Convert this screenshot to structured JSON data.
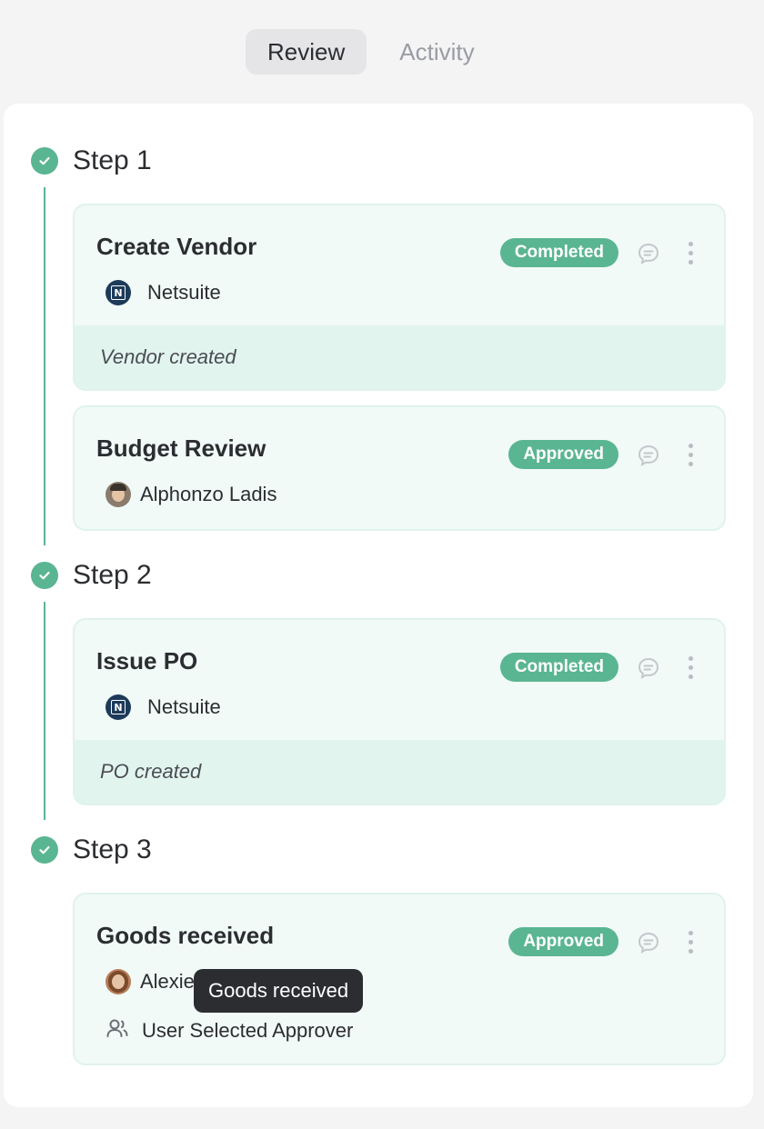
{
  "tabs": [
    {
      "label": "Review",
      "active": true
    },
    {
      "label": "Activity",
      "active": false
    }
  ],
  "steps": [
    {
      "title": "Step 1",
      "cards": [
        {
          "title": "Create Vendor",
          "status": "Completed",
          "assignee": "Netsuite",
          "assignee_icon": "netsuite-logo",
          "footer_note": "Vendor created"
        },
        {
          "title": "Budget Review",
          "status": "Approved",
          "assignee": "Alphonzo Ladis",
          "assignee_icon": "user-avatar"
        }
      ]
    },
    {
      "title": "Step 2",
      "cards": [
        {
          "title": "Issue PO",
          "status": "Completed",
          "assignee": "Netsuite",
          "assignee_icon": "netsuite-logo",
          "footer_note": "PO created"
        }
      ]
    },
    {
      "title": "Step 3",
      "cards": [
        {
          "title": "Goods received",
          "status": "Approved",
          "assignee": "Alexie",
          "assignee_icon": "user-avatar",
          "role": "User Selected Approver",
          "role_icon": "users-icon"
        }
      ]
    }
  ],
  "tooltip": "Goods received",
  "colors": {
    "accent": "#5ab592",
    "card_bg": "#f1faf7",
    "footer_bg": "#e2f4ee",
    "tooltip_bg": "#2b2d31"
  }
}
